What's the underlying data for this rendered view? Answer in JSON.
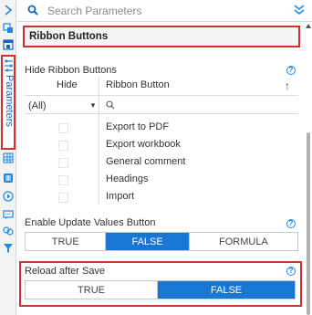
{
  "search": {
    "placeholder": "Search Parameters"
  },
  "rail": {
    "params_label": "Parameters",
    "icons": [
      "collapse-arrow-icon",
      "data-source-icon",
      "layout-icon",
      "parameters-icon",
      "grid-icon",
      "table-icon",
      "play-icon",
      "comment-icon",
      "link-icon",
      "filter-icon"
    ]
  },
  "section": {
    "title": "Ribbon Buttons"
  },
  "hide_ribbon": {
    "label": "Hide Ribbon Buttons",
    "columns": [
      "Hide",
      "Ribbon Button"
    ],
    "filter_value": "(All)",
    "rows": [
      {
        "label": "Export to PDF",
        "checked": false
      },
      {
        "label": "Export workbook",
        "checked": false
      },
      {
        "label": "General comment",
        "checked": false
      },
      {
        "label": "Headings",
        "checked": false
      },
      {
        "label": "Import",
        "checked": false
      }
    ]
  },
  "update_values": {
    "label": "Enable Update Values Button",
    "options": [
      "TRUE",
      "FALSE",
      "FORMULA"
    ],
    "selected": "FALSE"
  },
  "reload": {
    "label": "Reload after Save",
    "options": [
      "TRUE",
      "FALSE"
    ],
    "selected": "FALSE"
  },
  "colors": {
    "accent": "#1976d2",
    "highlight": "#d32f2f",
    "link": "#1565c0"
  }
}
